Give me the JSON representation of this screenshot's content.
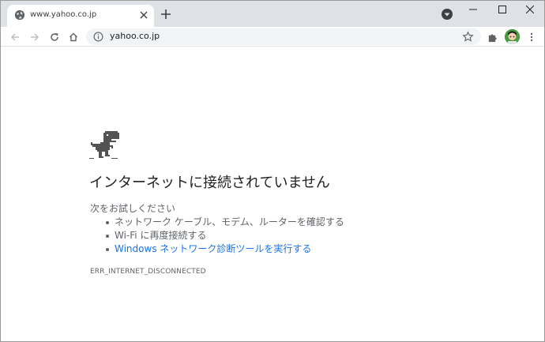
{
  "tab": {
    "title": "www.yahoo.co.jp",
    "favicon": "globe-icon"
  },
  "omnibox": {
    "url": "yahoo.co.jp",
    "info_icon": "info-icon",
    "bookmark_icon": "star-icon"
  },
  "toolbar": {
    "back_icon": "back-arrow-icon",
    "forward_icon": "forward-arrow-icon",
    "reload_icon": "reload-icon",
    "home_icon": "home-icon",
    "extensions_icon": "puzzle-icon",
    "menu_icon": "kebab-menu-icon"
  },
  "window_controls": [
    "minimize-icon",
    "maximize-icon",
    "close-icon"
  ],
  "error_page": {
    "heading": "インターネットに接続されていません",
    "suggestions_title": "次をお試しください",
    "suggestions": [
      {
        "text": "ネットワーク ケーブル、モデム、ルーターを確認する",
        "link": false
      },
      {
        "text": "Wi-Fi に再度接続する",
        "link": false
      },
      {
        "text": "Windows ネットワーク診断ツールを実行する",
        "link": true
      }
    ],
    "error_code": "ERR_INTERNET_DISCONNECTED"
  },
  "colors": {
    "tabstrip": "#dee1e6",
    "link": "#1a73e8",
    "text": "#202124",
    "secondary_text": "#5f6368"
  }
}
